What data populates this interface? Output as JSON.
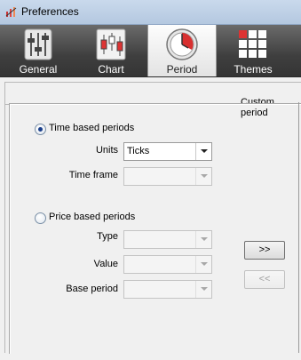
{
  "window": {
    "title": "Preferences",
    "icon": "preferences-app-icon"
  },
  "toolbar": {
    "tabs": [
      {
        "label": "General",
        "icon": "sliders-icon",
        "active": false
      },
      {
        "label": "Chart",
        "icon": "candlestick-chart-icon",
        "active": false
      },
      {
        "label": "Period",
        "icon": "clock-icon",
        "active": true
      },
      {
        "label": "Themes",
        "icon": "grid-icon",
        "active": false
      }
    ]
  },
  "custom_period": {
    "group_title": "Custom period",
    "time_based": {
      "label": "Time based periods",
      "selected": true,
      "units_label": "Units",
      "units_value": "Ticks",
      "timeframe_label": "Time frame",
      "timeframe_value": ""
    },
    "price_based": {
      "label": "Price based periods",
      "selected": false,
      "type_label": "Type",
      "value_label": "Value",
      "base_period_label": "Base period"
    },
    "add_button": ">>",
    "remove_button": "<<"
  },
  "colors": {
    "toolbar_dark": "#3f3f3f",
    "radio_dot": "#1b3f8b"
  }
}
